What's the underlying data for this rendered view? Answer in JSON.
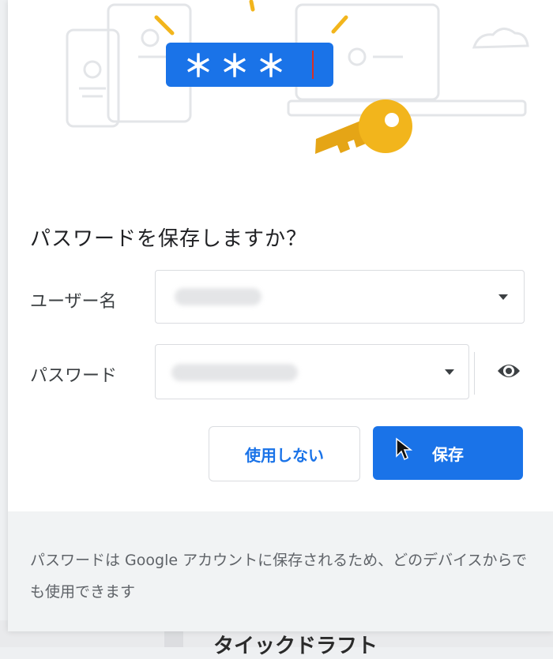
{
  "dialog": {
    "title": "パスワードを保存しますか？",
    "hero_password_mask": "＊＊＊",
    "username_label": "ユーザー名",
    "password_label": "パスワード",
    "username_value": "",
    "password_value": "",
    "never_button": "使用しない",
    "save_button": "保存",
    "footer_text": "パスワードは Google アカウントに保存されるため、どのデバイスからでも使用できます"
  },
  "background": {
    "partial_text": "タイックドラフト"
  },
  "colors": {
    "primary": "#1a73e8",
    "key": "#f2b51c",
    "footer_bg": "#f1f3f4"
  },
  "icons": {
    "username_dropdown": "chevron-down-icon",
    "password_dropdown": "chevron-down-icon",
    "reveal_password": "eye-icon",
    "hero_key": "key-icon"
  }
}
